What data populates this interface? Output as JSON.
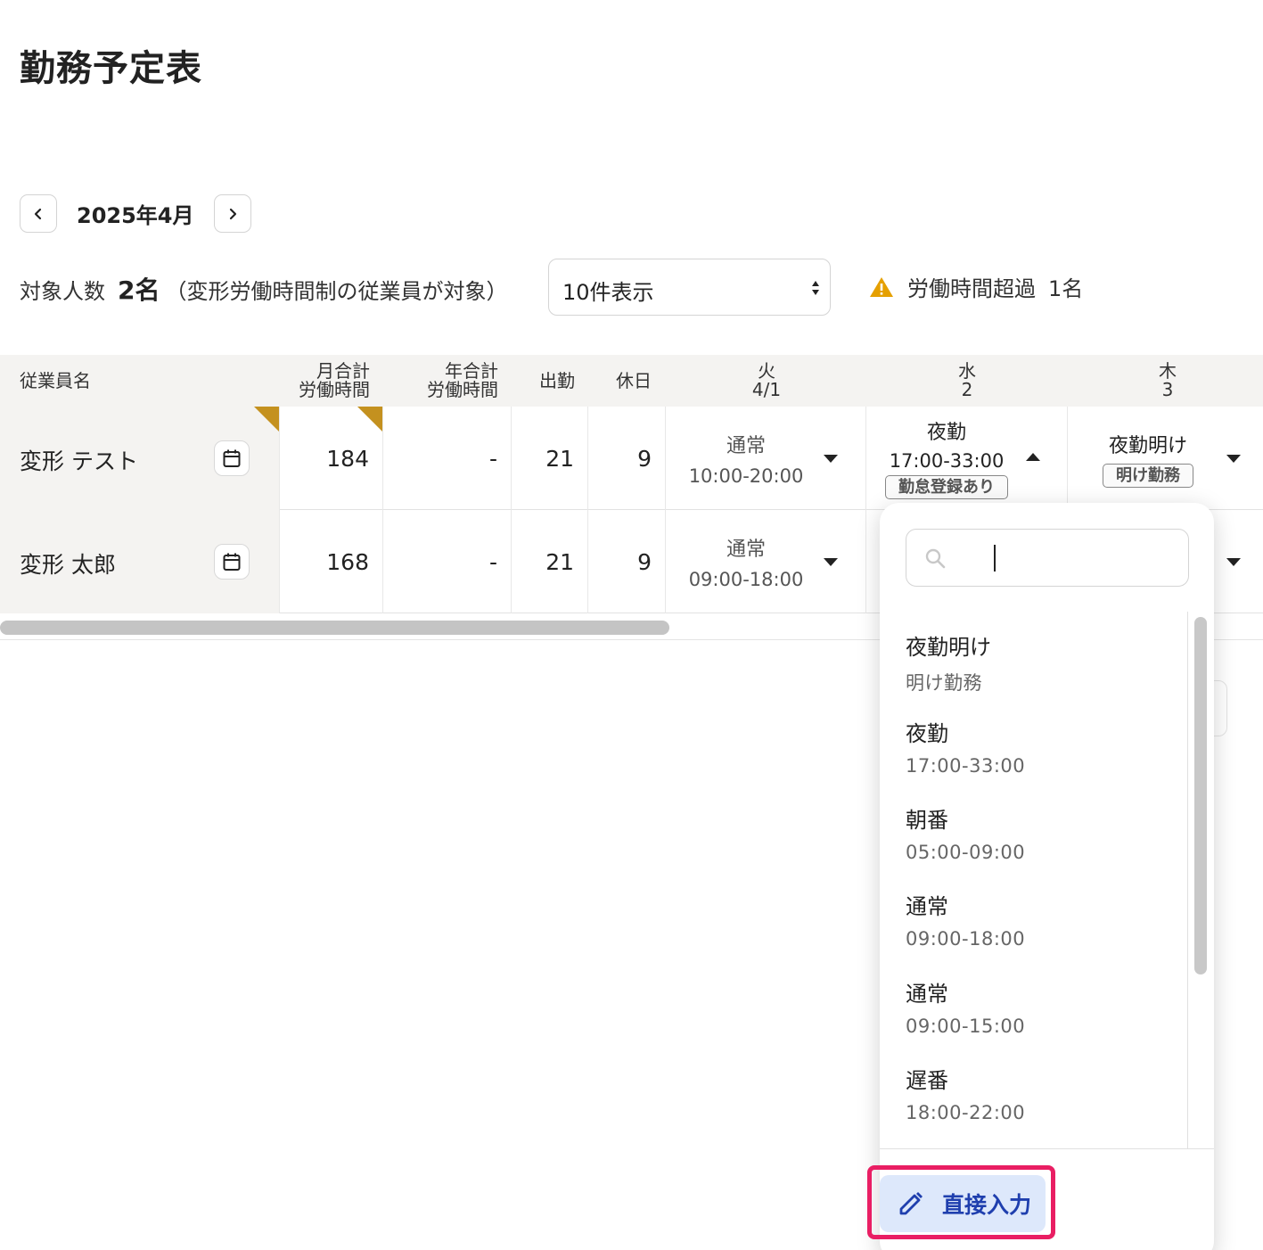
{
  "page": {
    "title": "勤務予定表"
  },
  "month_nav": {
    "label": "2025年4月",
    "prev_icon": "chevron-left",
    "next_icon": "chevron-right"
  },
  "summary": {
    "count_label": "対象人数",
    "count_value": "2名",
    "count_note": "（変形労働時間制の従業員が対象）",
    "per_page": "10件表示",
    "warning_label": "労働時間超過",
    "warning_count": "1名",
    "warning_color": "#e5a000"
  },
  "table": {
    "headers": {
      "name": "従業員名",
      "monthly_l1": "月合計",
      "monthly_l2": "労働時間",
      "yearly_l1": "年合計",
      "yearly_l2": "労働時間",
      "work": "出勤",
      "off": "休日",
      "d1_wd": "火",
      "d1_date": "4/1",
      "d2_wd": "水",
      "d2_date": "2",
      "d3_wd": "木",
      "d3_date": "3"
    },
    "rows": [
      {
        "name": "変形 テスト",
        "monthly": "184",
        "yearly": "-",
        "work": "21",
        "off": "9",
        "d1": {
          "name": "通常",
          "time": "10:00-20:00"
        },
        "d2": {
          "name": "夜勤",
          "time": "17:00-33:00",
          "badge": "勤怠登録あり"
        },
        "d3": {
          "name": "夜勤明け",
          "badge": "明け勤務"
        }
      },
      {
        "name": "変形 太郎",
        "monthly": "168",
        "yearly": "-",
        "work": "21",
        "off": "9",
        "d1": {
          "name": "通常",
          "time": "09:00-18:00"
        }
      }
    ],
    "flag_color": "#c4911f"
  },
  "dropdown": {
    "search_placeholder": "",
    "options": [
      {
        "name": "夜勤明け",
        "detail": "明け勤務"
      },
      {
        "name": "夜勤",
        "detail": "17:00-33:00"
      },
      {
        "name": "朝番",
        "detail": "05:00-09:00"
      },
      {
        "name": "通常",
        "detail": "09:00-18:00"
      },
      {
        "name": "通常",
        "detail": "09:00-15:00"
      },
      {
        "name": "遅番",
        "detail": "18:00-22:00"
      }
    ],
    "direct_input_label": "直接入力",
    "highlight_color": "#e91e63",
    "button_color": "#dde8fb"
  }
}
